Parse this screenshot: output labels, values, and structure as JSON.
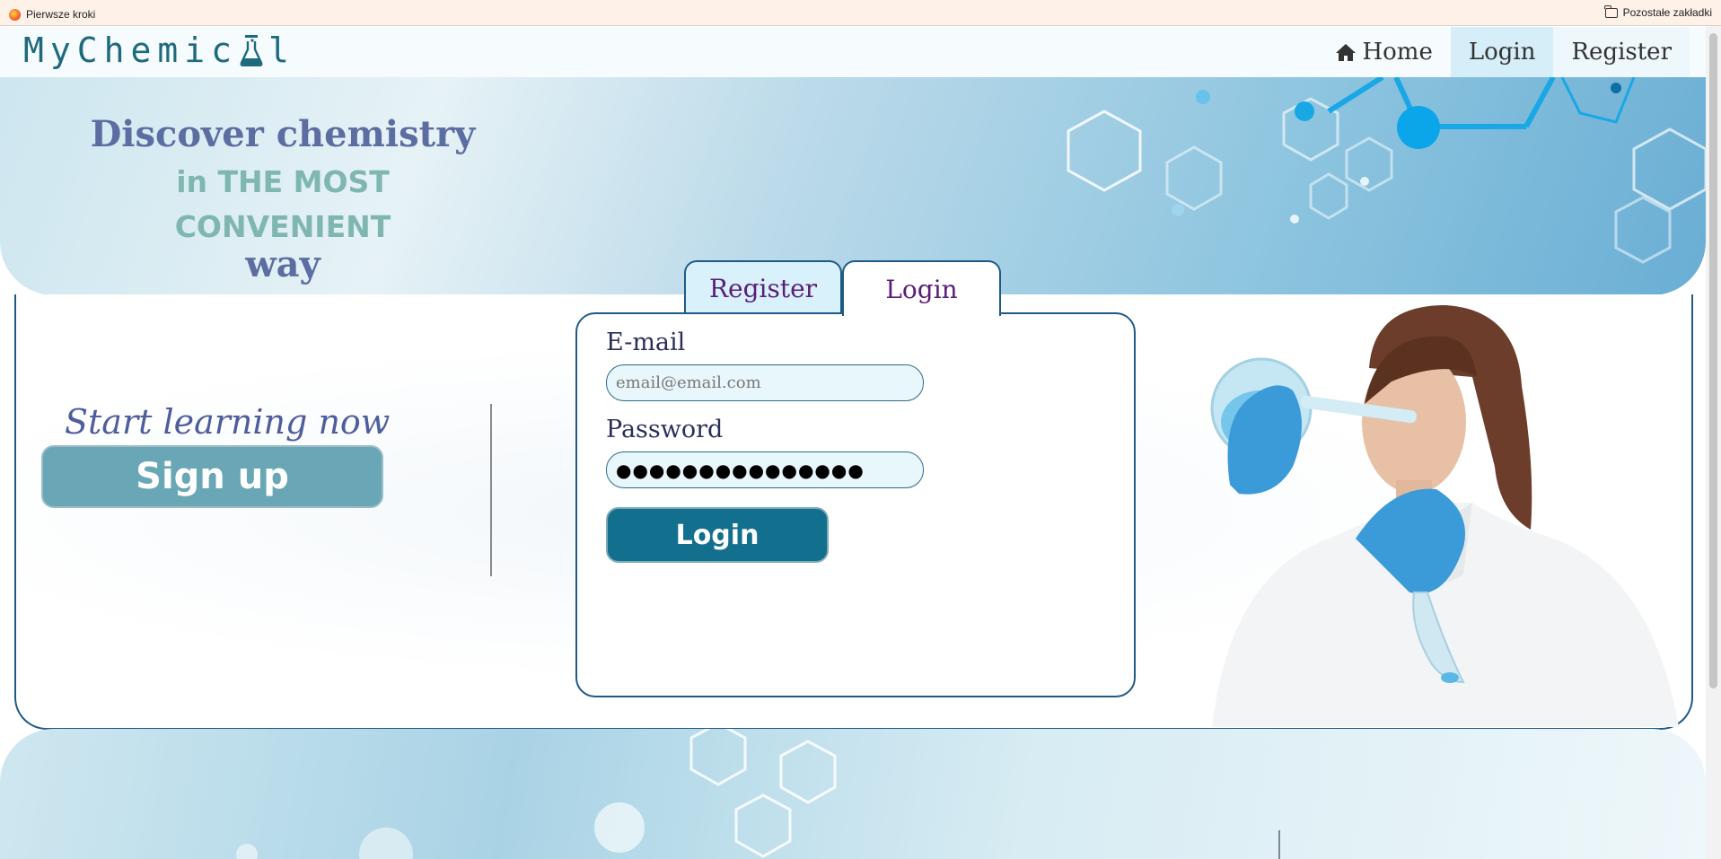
{
  "bookmarks": {
    "first_steps": "Pierwsze kroki",
    "other_bookmarks": "Pozostałe zakładki"
  },
  "nav": {
    "logo_text_left": "MyChemic",
    "logo_text_right": "l",
    "home": "Home",
    "login": "Login",
    "register": "Register"
  },
  "hero": {
    "line1": "Discover chemistry",
    "line2": "in THE MOST",
    "line3": "CONVENIENT",
    "line4": "way"
  },
  "tabs": {
    "register": "Register",
    "login": "Login"
  },
  "cta": {
    "text": "Start learning now",
    "signup": "Sign up"
  },
  "form": {
    "email_label": "E-mail",
    "email_placeholder": "email@email.com",
    "password_label": "Password",
    "password_value": "●●●●●●●●●●●●●●●",
    "login_button": "Login"
  },
  "colors": {
    "accent_dark": "#136f8e",
    "signup": "#69a6b6",
    "tab_text": "#5b1d79",
    "border": "#1f5a85"
  }
}
